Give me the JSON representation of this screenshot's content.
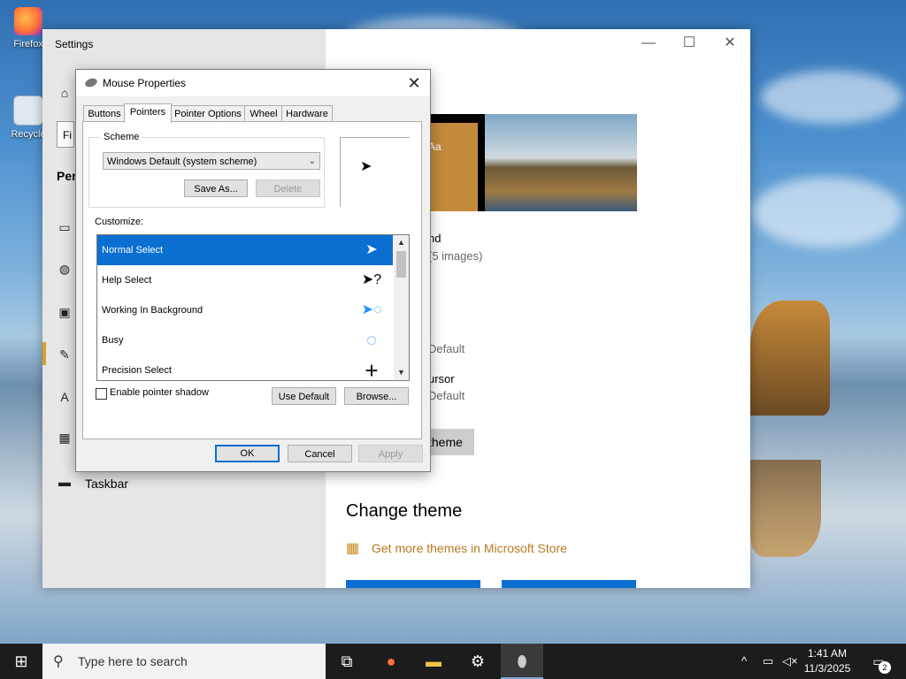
{
  "desktop": {
    "icons": [
      {
        "label": "Firefox",
        "icon": "firefox-icon"
      },
      {
        "label": "Recycle",
        "icon": "recycle-bin-icon"
      }
    ]
  },
  "settings": {
    "title": "Settings",
    "window_controls": {
      "minimize": "—",
      "maximize": "☐",
      "close": "✕"
    },
    "search_placeholder": "Fi",
    "section_heading": "Pers",
    "nav_items": [
      {
        "icon": "home-icon",
        "glyph": "⌂"
      },
      {
        "icon": "picture-icon",
        "glyph": "▭"
      },
      {
        "icon": "palette-icon",
        "glyph": "◍"
      },
      {
        "icon": "lock-screen-icon",
        "glyph": "▣"
      },
      {
        "icon": "themes-icon",
        "glyph": "✎"
      },
      {
        "icon": "fonts-icon",
        "glyph": "A"
      },
      {
        "icon": "start-icon",
        "glyph": "▦"
      },
      {
        "icon": "taskbar-icon",
        "glyph": "▬",
        "label": "Taskbar"
      }
    ],
    "preview_tile_text": "Aa",
    "background_label": "nd",
    "background_sub": "(5 images)",
    "color_partial": ":",
    "sound_label": "Default",
    "cursor_label": "ursor",
    "cursor_value": "Default",
    "save_theme_label": "theme",
    "change_theme": "Change theme",
    "store_link": "Get more themes in Microsoft Store"
  },
  "dialog": {
    "title": "Mouse Properties",
    "tabs": [
      "Buttons",
      "Pointers",
      "Pointer Options",
      "Wheel",
      "Hardware"
    ],
    "active_tab": "Pointers",
    "scheme_label": "Scheme",
    "scheme_value": "Windows Default (system scheme)",
    "save_as": "Save As...",
    "delete": "Delete",
    "customize_label": "Customize:",
    "pointers": [
      {
        "name": "Normal Select",
        "cursor": "arrow-cursor-icon",
        "glyph": "➤",
        "selected": true
      },
      {
        "name": "Help Select",
        "cursor": "help-cursor-icon",
        "glyph": "➤?"
      },
      {
        "name": "Working In Background",
        "cursor": "working-cursor-icon",
        "glyph": "➤◌"
      },
      {
        "name": "Busy",
        "cursor": "busy-cursor-icon",
        "glyph": "◌"
      },
      {
        "name": "Precision Select",
        "cursor": "crosshair-cursor-icon",
        "glyph": "+"
      }
    ],
    "shadow_label": "Enable pointer shadow",
    "shadow_checked": false,
    "use_default": "Use Default",
    "browse": "Browse...",
    "ok": "OK",
    "cancel": "Cancel",
    "apply": "Apply"
  },
  "taskbar": {
    "search_placeholder": "Type here to search",
    "apps": [
      "task-view-icon",
      "firefox-icon",
      "file-explorer-icon",
      "settings-icon",
      "mouse-icon"
    ],
    "time": "1:41 AM",
    "date": "11/3/2025",
    "notification_count": "2"
  },
  "colors": {
    "accent": "#0a6fd0",
    "settings_accent": "#d4a12a",
    "store_link": "#b7791f"
  }
}
